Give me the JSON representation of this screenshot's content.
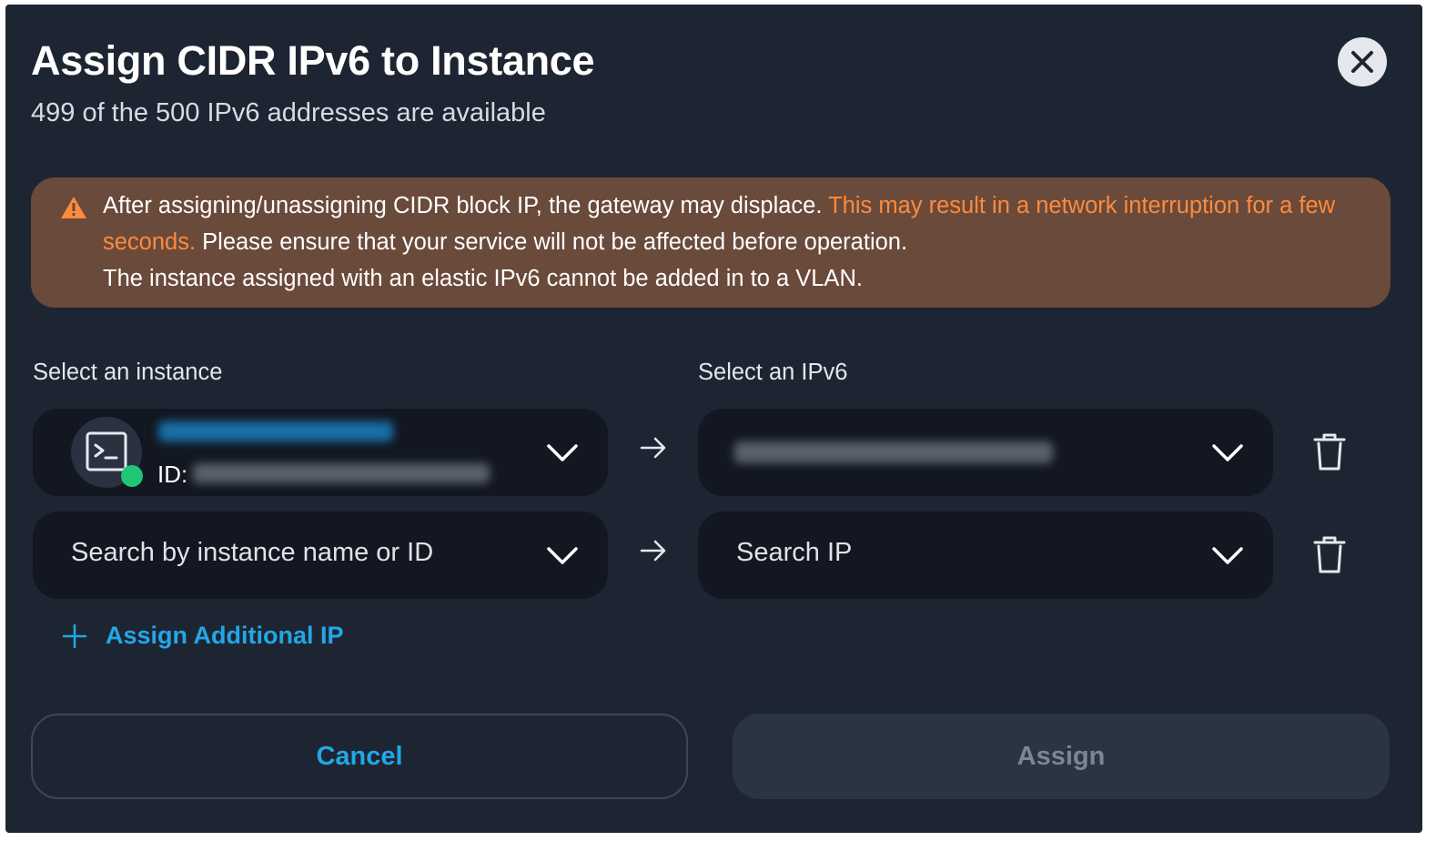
{
  "dialog": {
    "title": "Assign CIDR IPv6 to Instance",
    "subtitle": "499 of the 500 IPv6 addresses are available",
    "close_icon": "close-icon"
  },
  "warning": {
    "icon": "warning-triangle-icon",
    "text_part1": "After assigning/unassigning CIDR block IP, the gateway may displace. ",
    "text_highlight": "This may result in a network interruption for a few seconds.",
    "text_part2": " Please ensure that your service will not be affected before operation.",
    "text_line3": "The instance assigned with an elastic IPv6 cannot be added in to a VLAN.",
    "highlight_color": "#ff8a3d"
  },
  "labels": {
    "instance": "Select an instance",
    "ipv6": "Select an IPv6"
  },
  "rows": [
    {
      "instance": {
        "icon": "terminal-icon",
        "id_label": "ID:",
        "status": "running"
      },
      "ip": {}
    },
    {
      "instance": {
        "placeholder": "Search by instance name or ID"
      },
      "ip": {
        "placeholder": "Search IP"
      }
    }
  ],
  "add_ip_label": "Assign Additional IP",
  "buttons": {
    "cancel": "Cancel",
    "assign": "Assign"
  },
  "colors": {
    "accent": "#22a7e8",
    "background": "#1e2532",
    "warning_bg": "#6a4a3b",
    "status_green": "#1fc676"
  }
}
